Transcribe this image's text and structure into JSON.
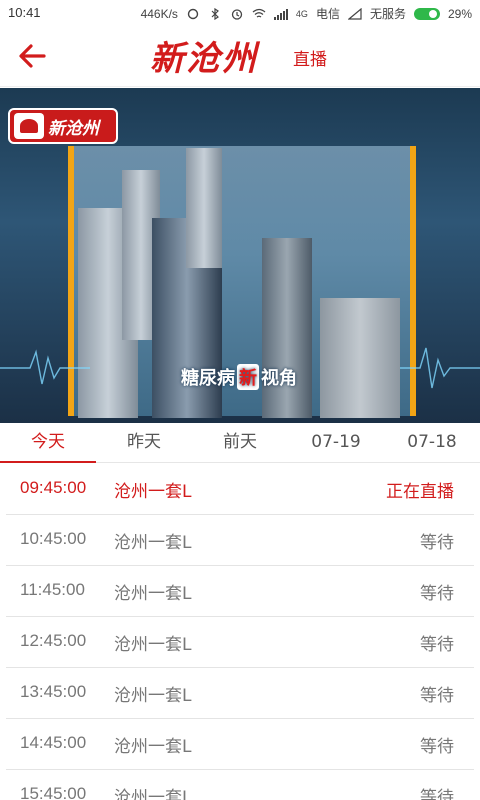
{
  "status_bar": {
    "time": "10:41",
    "network_speed": "446K/s",
    "signal_label": "4G",
    "carrier": "电信",
    "service": "无服务",
    "battery": "29%"
  },
  "app_bar": {
    "logo": "新沧州",
    "live_label": "直播"
  },
  "video": {
    "channel_logo_text": "新沧州",
    "caption_left": "糖尿病",
    "caption_highlight": "新",
    "caption_right": "视角"
  },
  "tabs": [
    {
      "label": "今天",
      "active": true
    },
    {
      "label": "昨天",
      "active": false
    },
    {
      "label": "前天",
      "active": false
    },
    {
      "label": "07-19",
      "active": false
    },
    {
      "label": "07-18",
      "active": false
    }
  ],
  "schedule": [
    {
      "time": "09:45:00",
      "program": "沧州一套L",
      "status": "正在直播",
      "live": true
    },
    {
      "time": "10:45:00",
      "program": "沧州一套L",
      "status": "等待",
      "live": false
    },
    {
      "time": "11:45:00",
      "program": "沧州一套L",
      "status": "等待",
      "live": false
    },
    {
      "time": "12:45:00",
      "program": "沧州一套L",
      "status": "等待",
      "live": false
    },
    {
      "time": "13:45:00",
      "program": "沧州一套L",
      "status": "等待",
      "live": false
    },
    {
      "time": "14:45:00",
      "program": "沧州一套L",
      "status": "等待",
      "live": false
    },
    {
      "time": "15:45:00",
      "program": "沧州一套L",
      "status": "等待",
      "live": false
    }
  ],
  "colors": {
    "accent": "#d21c1c",
    "frame": "#f2a516",
    "muted_text": "#777777"
  },
  "icons": {
    "back": "arrow-left-icon"
  }
}
